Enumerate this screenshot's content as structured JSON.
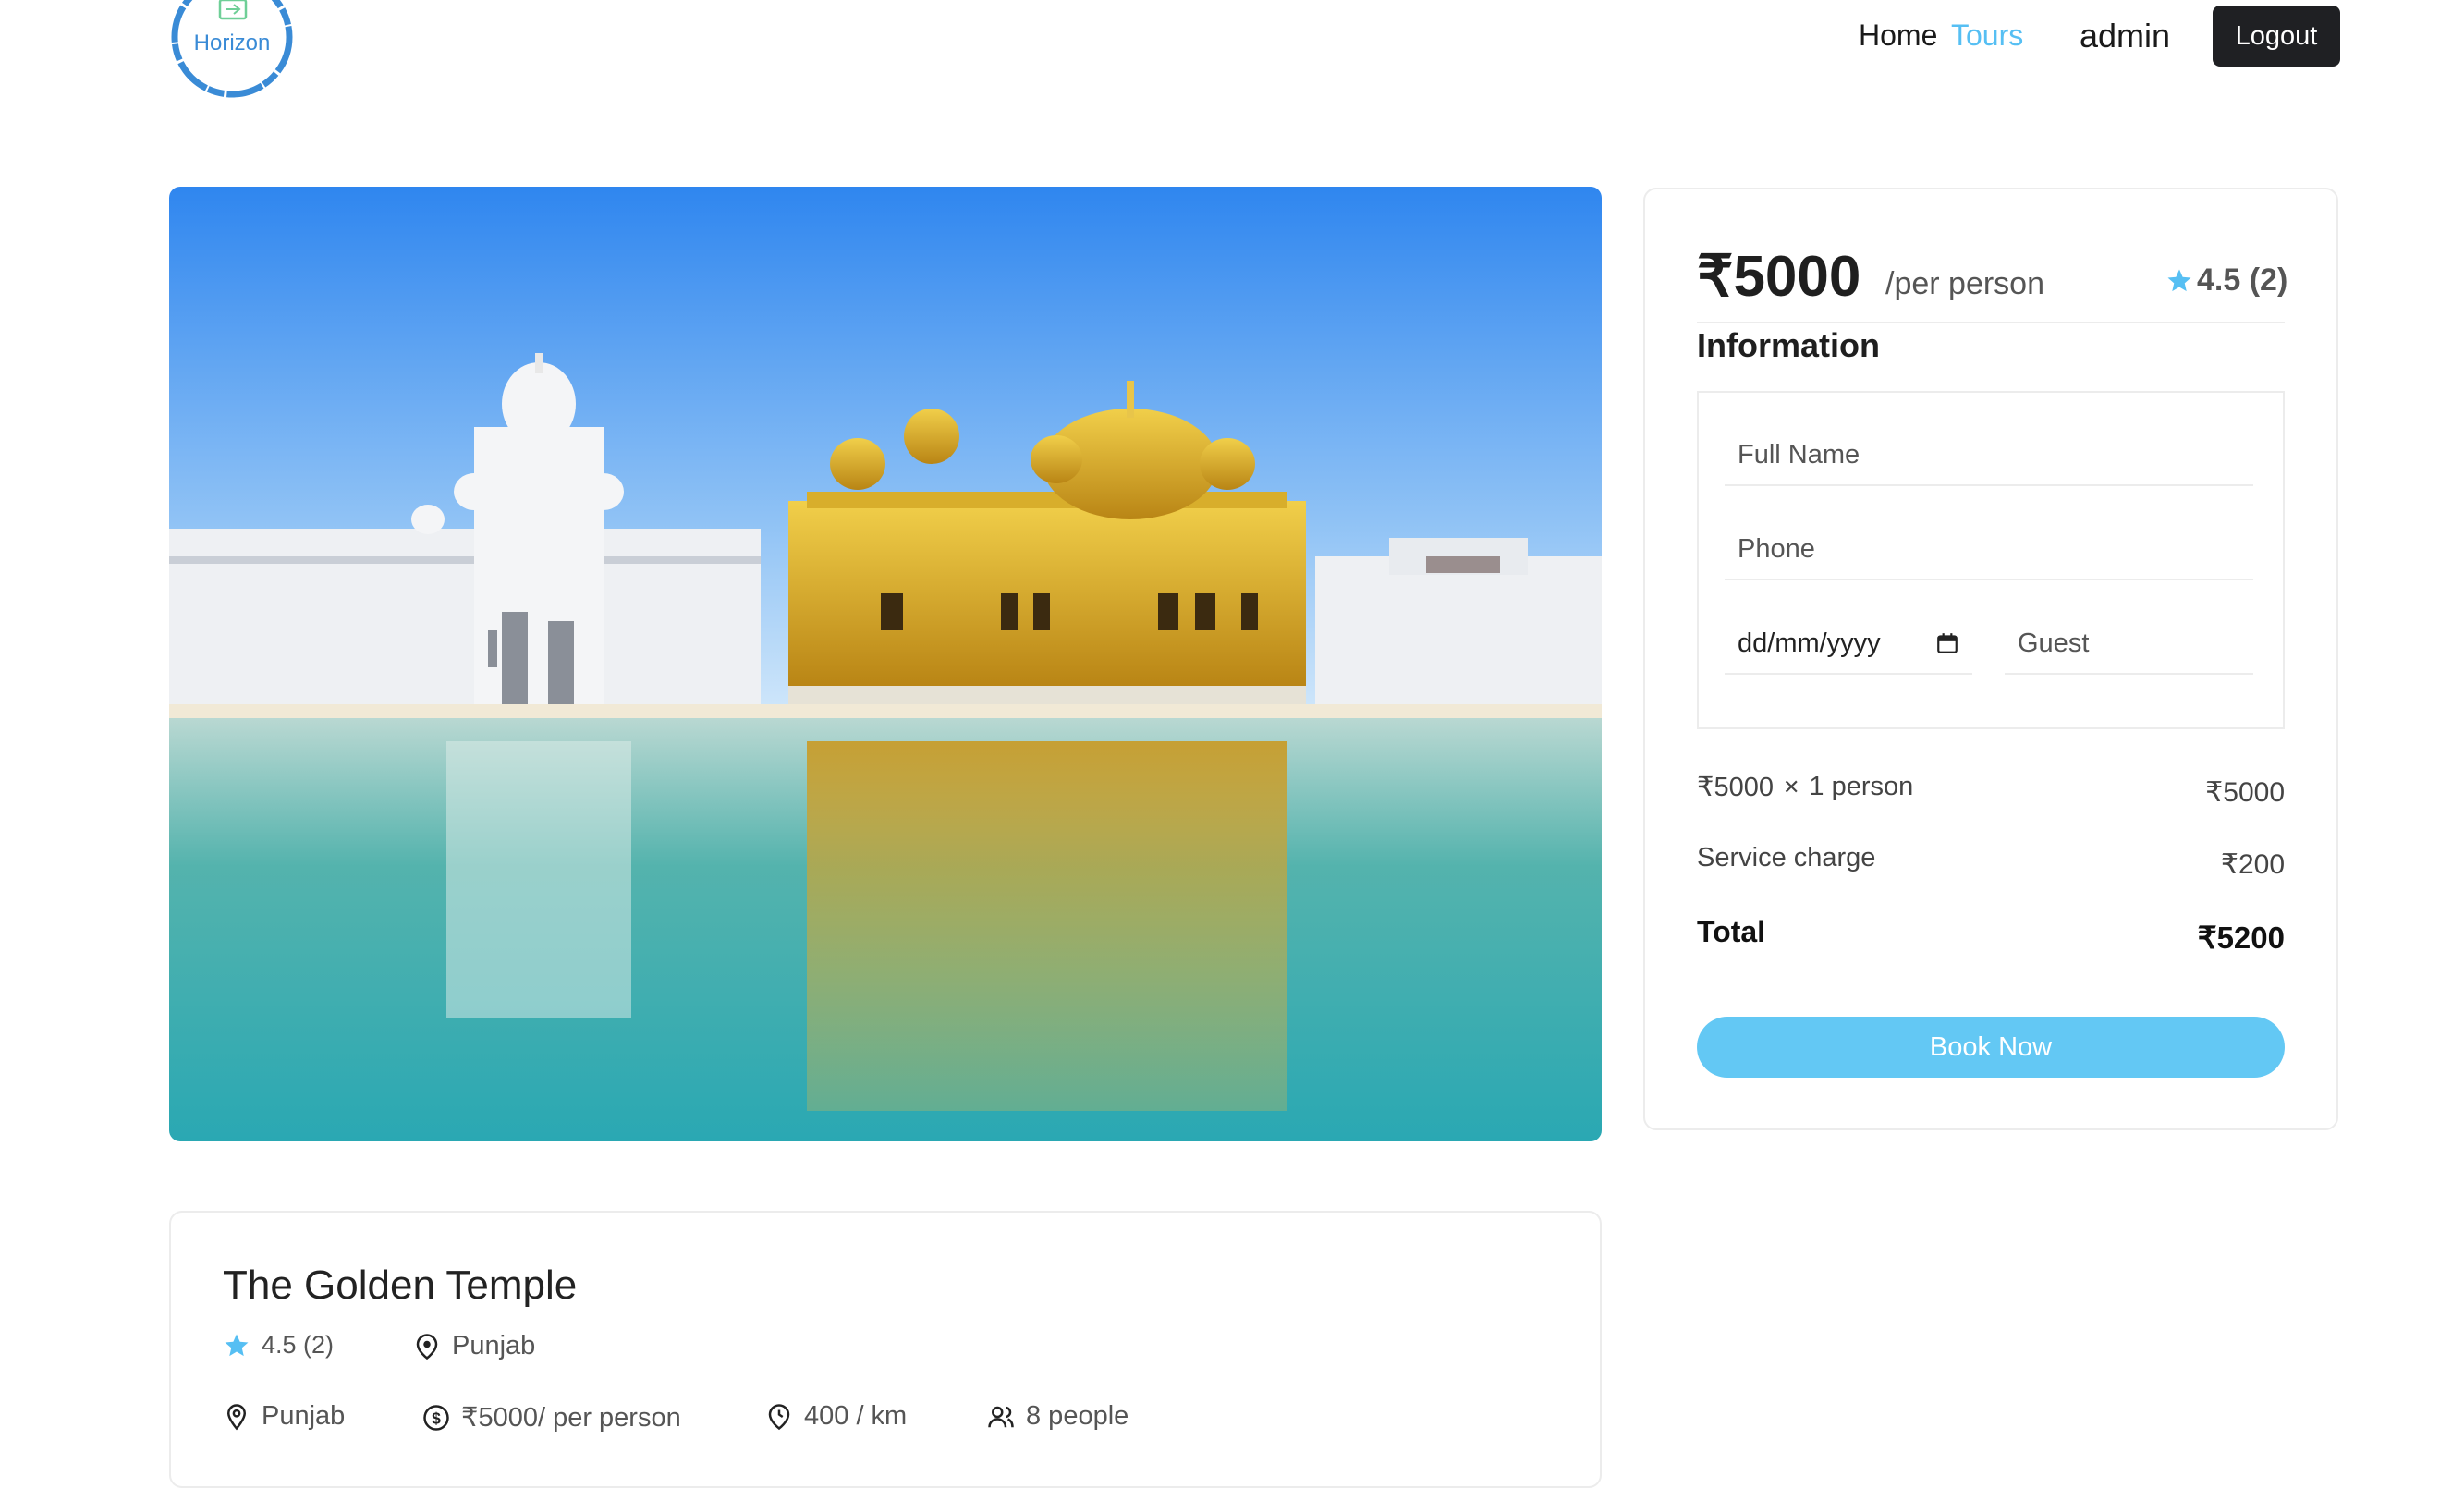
{
  "header": {
    "logo_text": "Horizon",
    "nav": {
      "home": "Home",
      "tours": "Tours"
    },
    "user": "admin",
    "logout_label": "Logout"
  },
  "booking": {
    "price": "₹5000",
    "per_label": "/per person",
    "rating": "4.5 (2)",
    "info_title": "Information",
    "form": {
      "full_name_placeholder": "Full Name",
      "phone_placeholder": "Phone",
      "date_placeholder": "dd/mm/yyyy",
      "guest_placeholder": "Guest"
    },
    "summary": {
      "unit_price": "₹5000",
      "times": "✕",
      "quantity": "1 person",
      "subtotal": "₹5000",
      "service_label": "Service charge",
      "service_value": "₹200",
      "total_label": "Total",
      "total_value": "₹5200"
    },
    "book_label": "Book Now"
  },
  "tour": {
    "title": "The Golden Temple",
    "rating": "4.5 (2)",
    "city": "Punjab",
    "address": "Punjab",
    "price": "₹5000/ per person",
    "distance": "400 / km",
    "group_size": "8 people"
  },
  "colors": {
    "accent": "#56bff3",
    "button": "#63c8f4",
    "dark": "#1f2023",
    "star": "#56bff3"
  },
  "icons": [
    "logo-icon",
    "star-icon",
    "map-pin-icon",
    "location-icon",
    "dollar-icon",
    "clock-pin-icon",
    "users-icon",
    "calendar-icon"
  ]
}
